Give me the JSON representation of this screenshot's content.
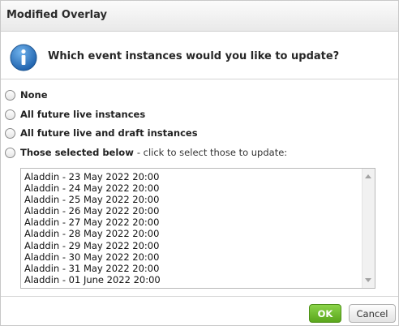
{
  "dialog": {
    "title": "Modified Overlay",
    "question": "Which event instances would you like to update?",
    "info_icon": "info-icon"
  },
  "options": [
    {
      "label": "None",
      "hint": ""
    },
    {
      "label": "All future live instances",
      "hint": ""
    },
    {
      "label": "All future live and draft instances",
      "hint": ""
    },
    {
      "label": "Those selected below",
      "hint": "- click to select those to update:"
    }
  ],
  "instances": [
    "Aladdin - 23 May 2022 20:00",
    "Aladdin - 24 May 2022 20:00",
    "Aladdin - 25 May 2022 20:00",
    "Aladdin - 26 May 2022 20:00",
    "Aladdin - 27 May 2022 20:00",
    "Aladdin - 28 May 2022 20:00",
    "Aladdin - 29 May 2022 20:00",
    "Aladdin - 30 May 2022 20:00",
    "Aladdin - 31 May 2022 20:00",
    "Aladdin - 01 June 2022 20:00"
  ],
  "buttons": {
    "ok": "OK",
    "cancel": "Cancel"
  },
  "colors": {
    "ok_button": "#6dbb2b",
    "info_icon": "#2a79c2"
  }
}
